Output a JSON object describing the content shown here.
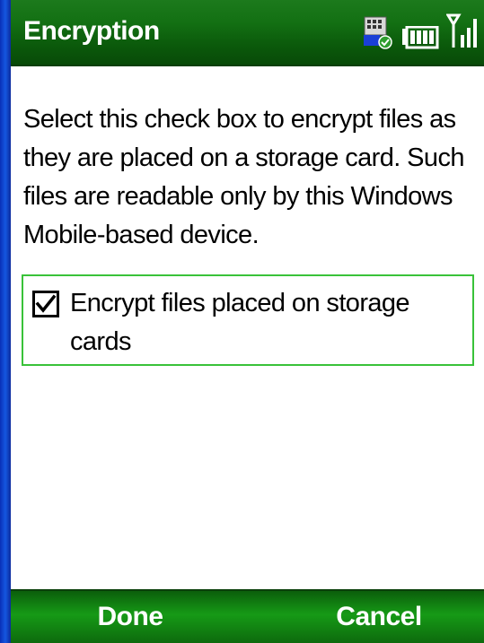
{
  "title_bar": {
    "title": "Encryption",
    "icons": [
      "connectivity-icon",
      "battery-icon",
      "signal-icon"
    ]
  },
  "content": {
    "description": "Select this check box to encrypt files as they are placed on a storage card. Such files are readable only by this Windows Mobile-based device.",
    "checkbox": {
      "label": "Encrypt files placed on storage cards",
      "checked": true
    }
  },
  "softkeys": {
    "left": "Done",
    "right": "Cancel"
  },
  "colors": {
    "title_bar": "#137013",
    "softkey_bar": "#169a16",
    "focus_border": "#39c239",
    "frame": "#0a2fb0"
  }
}
